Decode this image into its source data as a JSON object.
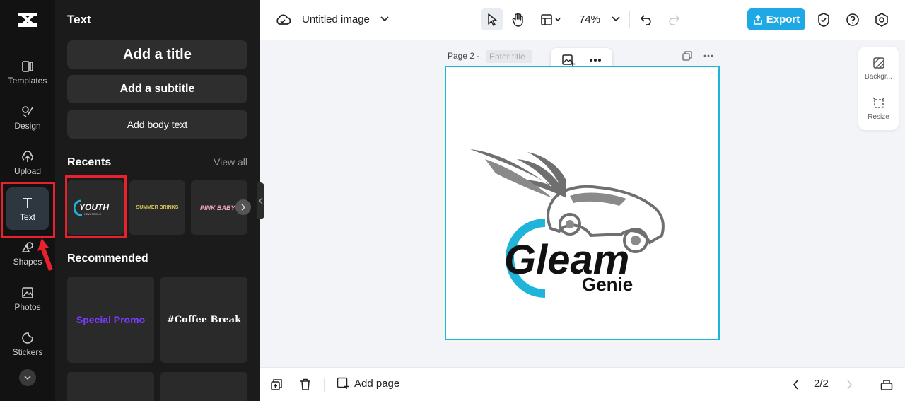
{
  "rail": {
    "items": [
      {
        "label": "Templates",
        "icon": "templates-icon"
      },
      {
        "label": "Design",
        "icon": "design-icon"
      },
      {
        "label": "Upload",
        "icon": "upload-icon"
      },
      {
        "label": "Text",
        "icon": "text-icon",
        "active": true
      },
      {
        "label": "Shapes",
        "icon": "shapes-icon"
      },
      {
        "label": "Photos",
        "icon": "photos-icon"
      },
      {
        "label": "Stickers",
        "icon": "stickers-icon"
      }
    ]
  },
  "panel": {
    "title": "Text",
    "add_title": "Add a title",
    "add_subtitle": "Add a subtitle",
    "add_body": "Add body text",
    "recents_heading": "Recents",
    "view_all": "View all",
    "recents": [
      {
        "label": "YOUTH",
        "sublabel": "NEW TOOLS",
        "color": "#ffffff"
      },
      {
        "label": "SUMMER DRINKS",
        "color": "#d9c85a"
      },
      {
        "label": "PINK BABY",
        "color": "#f3a4c0"
      }
    ],
    "recommended_heading": "Recommended",
    "recommended": [
      {
        "label": "Special Promo",
        "color": "#7b3cff"
      },
      {
        "label": "#Coffee Break",
        "color": "#ffffff"
      }
    ]
  },
  "topbar": {
    "doc_title": "Untitled image",
    "zoom": "74%",
    "export_label": "Export",
    "accent": "#1fa8e6"
  },
  "canvas": {
    "page_label": "Page 2 -",
    "title_placeholder": "Enter title",
    "logo_main": "Gleam",
    "logo_sub": "Genie",
    "border_color": "#1fb4d9"
  },
  "right_tools": {
    "background_label": "Backgr...",
    "resize_label": "Resize"
  },
  "bottombar": {
    "add_page": "Add page",
    "pager": "2/2"
  },
  "highlight_color": "#e8212e"
}
